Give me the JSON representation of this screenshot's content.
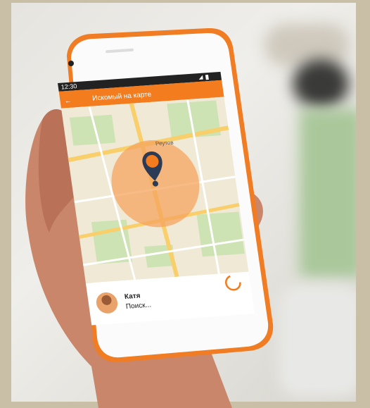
{
  "status_bar": {
    "time": "12:30"
  },
  "app_bar": {
    "title": "Искомый на карте",
    "back_icon": "arrow-left-icon"
  },
  "map": {
    "place_label": "Реутов",
    "pin_icon": "map-pin-icon",
    "accent": "#f27c1e",
    "radius_fill": "#f5a45e"
  },
  "contact": {
    "name": "Катя",
    "status": "Поиск...",
    "spinner_icon": "loading-spinner-icon"
  }
}
